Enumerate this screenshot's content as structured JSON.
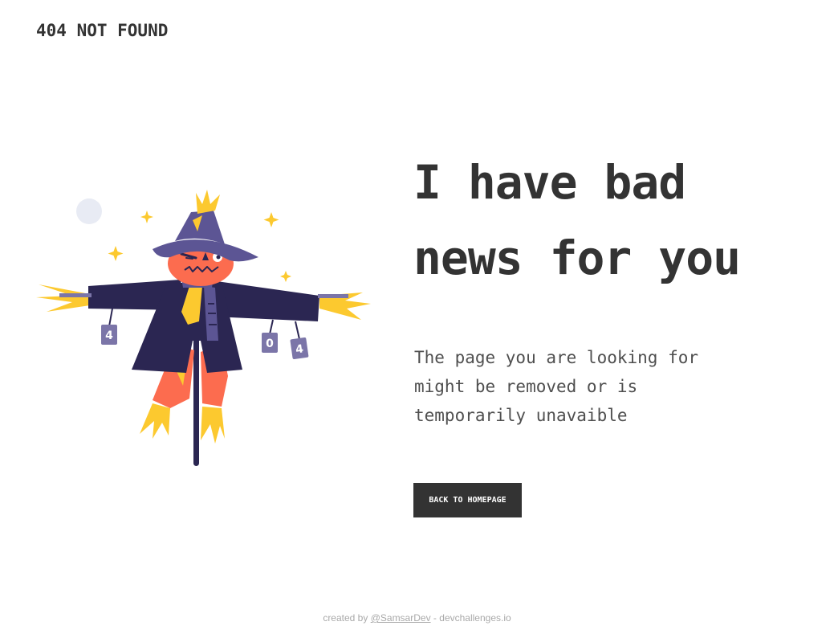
{
  "header": {
    "brand": "404 NOT FOUND"
  },
  "main": {
    "headline": "I have bad news for you",
    "message": "The page you are looking for might be removed or is temporarily unavaible",
    "button_label": "BACK TO HOMEPAGE",
    "can_labels": [
      "4",
      "0",
      "4"
    ]
  },
  "footer": {
    "prefix": "created by",
    "author": "@SamsarDev",
    "separator": "-",
    "site": "devchallenges.io"
  },
  "colors": {
    "text": "#333333",
    "coat": "#2b2652",
    "hat": "#5c5594",
    "face": "#fc6c4f",
    "straw": "#fcc92f",
    "can": "#7b75a8",
    "moon": "#e8ebf4"
  }
}
